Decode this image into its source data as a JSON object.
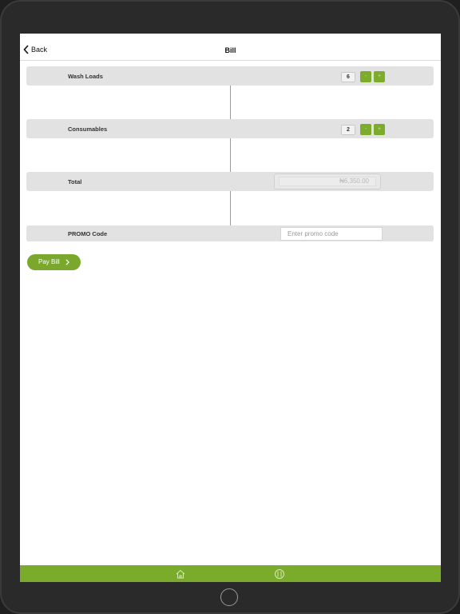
{
  "colors": {
    "accent": "#7aab2a",
    "row_bg": "#e2e2e2"
  },
  "nav": {
    "back_label": "Back",
    "title": "Bill",
    "back_icon": "chevron-left-icon"
  },
  "wash_loads": {
    "label": "Wash Loads",
    "count": "6",
    "minus": "-",
    "plus": "+"
  },
  "consumables": {
    "label": "Consumables",
    "count": "2",
    "minus": "-",
    "plus": "+"
  },
  "total": {
    "label": "Total",
    "value": "₦6,350.00"
  },
  "promo": {
    "label": "PROMO Code",
    "placeholder": "Enter promo code"
  },
  "pay": {
    "label": "Pay Bill",
    "icon": "chevron-right-icon"
  },
  "tabs": [
    {
      "icon": "home-icon"
    },
    {
      "icon": "wash-icon"
    }
  ]
}
